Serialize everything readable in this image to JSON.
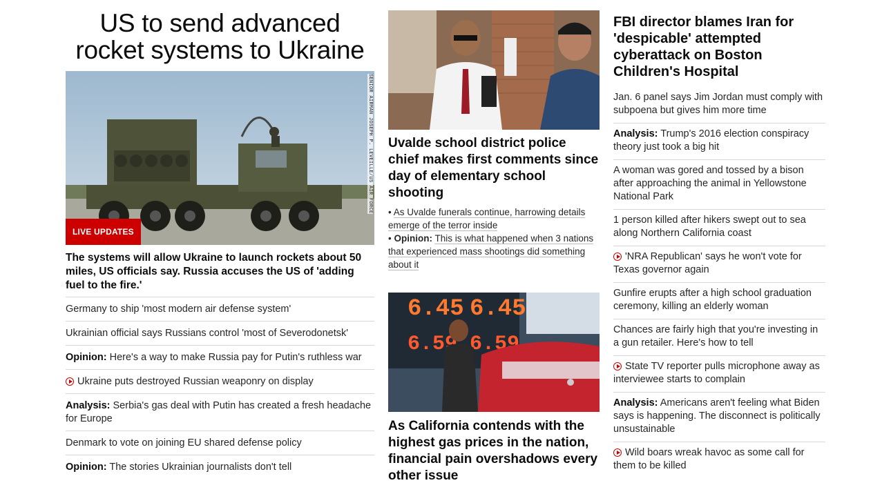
{
  "col1": {
    "headline": "US to send advanced rocket systems to Ukraine",
    "image_credit": "SENIOR AIRMAN JOSEPH P. LEVEILLE/US AIR FORCE",
    "badge": "LIVE UPDATES",
    "subheadline": "The systems will allow Ukraine to launch rockets about 50 miles, US officials say. Russia accuses the US of 'adding fuel to the fire.'",
    "links": [
      {
        "prefix": "",
        "text": "Germany to ship 'most modern air defense system'",
        "video": false
      },
      {
        "prefix": "",
        "text": "Ukrainian official says Russians control 'most of Severodonetsk'",
        "video": false
      },
      {
        "prefix": "Opinion:",
        "text": "Here's a way to make Russia pay for Putin's ruthless war",
        "video": false
      },
      {
        "prefix": "",
        "text": "Ukraine puts destroyed Russian weaponry on display",
        "video": true
      },
      {
        "prefix": "Analysis:",
        "text": "Serbia's gas deal with Putin has created a fresh headache for Europe",
        "video": false
      },
      {
        "prefix": "",
        "text": "Denmark to vote on joining EU shared defense policy",
        "video": false
      },
      {
        "prefix": "Opinion:",
        "text": "The stories Ukrainian journalists don't tell",
        "video": false
      }
    ]
  },
  "col2": {
    "story1": {
      "title": "Uvalde school district police chief makes first comments since day of elementary school shooting",
      "sublinks": [
        {
          "prefix": "",
          "text": "As Uvalde funerals continue, harrowing details emerge of the terror inside"
        },
        {
          "prefix": "Opinion:",
          "text": "This is what happened when 3 nations that experienced mass shootings did something about it"
        }
      ]
    },
    "story2": {
      "sign_price": "6.45",
      "sign_price_2": "6.59",
      "title": "As California contends with the highest gas prices in the nation, financial pain overshadows every other issue"
    }
  },
  "col3": {
    "headline": "FBI director blames Iran for 'despicable' attempted cyberattack on Boston Children's Hospital",
    "links": [
      {
        "prefix": "",
        "text": "Jan. 6 panel says Jim Jordan must comply with subpoena but gives him more time",
        "video": false
      },
      {
        "prefix": "Analysis:",
        "text": "Trump's 2016 election conspiracy theory just took a big hit",
        "video": false
      },
      {
        "prefix": "",
        "text": "A woman was gored and tossed by a bison after approaching the animal in Yellowstone National Park",
        "video": false
      },
      {
        "prefix": "",
        "text": "1 person killed after hikers swept out to sea along Northern California coast",
        "video": false
      },
      {
        "prefix": "",
        "text": "'NRA Republican' says he won't vote for Texas governor again",
        "video": true
      },
      {
        "prefix": "",
        "text": "Gunfire erupts after a high school graduation ceremony, killing an elderly woman",
        "video": false
      },
      {
        "prefix": "",
        "text": "Chances are fairly high that you're investing in a gun retailer. Here's how to tell",
        "video": false
      },
      {
        "prefix": "",
        "text": "State TV reporter pulls microphone away as interviewee starts to complain",
        "video": true
      },
      {
        "prefix": "Analysis:",
        "text": "Americans aren't feeling what Biden says is happening. The disconnect is politically unsustainable",
        "video": false
      },
      {
        "prefix": "",
        "text": "Wild boars wreak havoc as some call for them to be killed",
        "video": true
      }
    ]
  }
}
